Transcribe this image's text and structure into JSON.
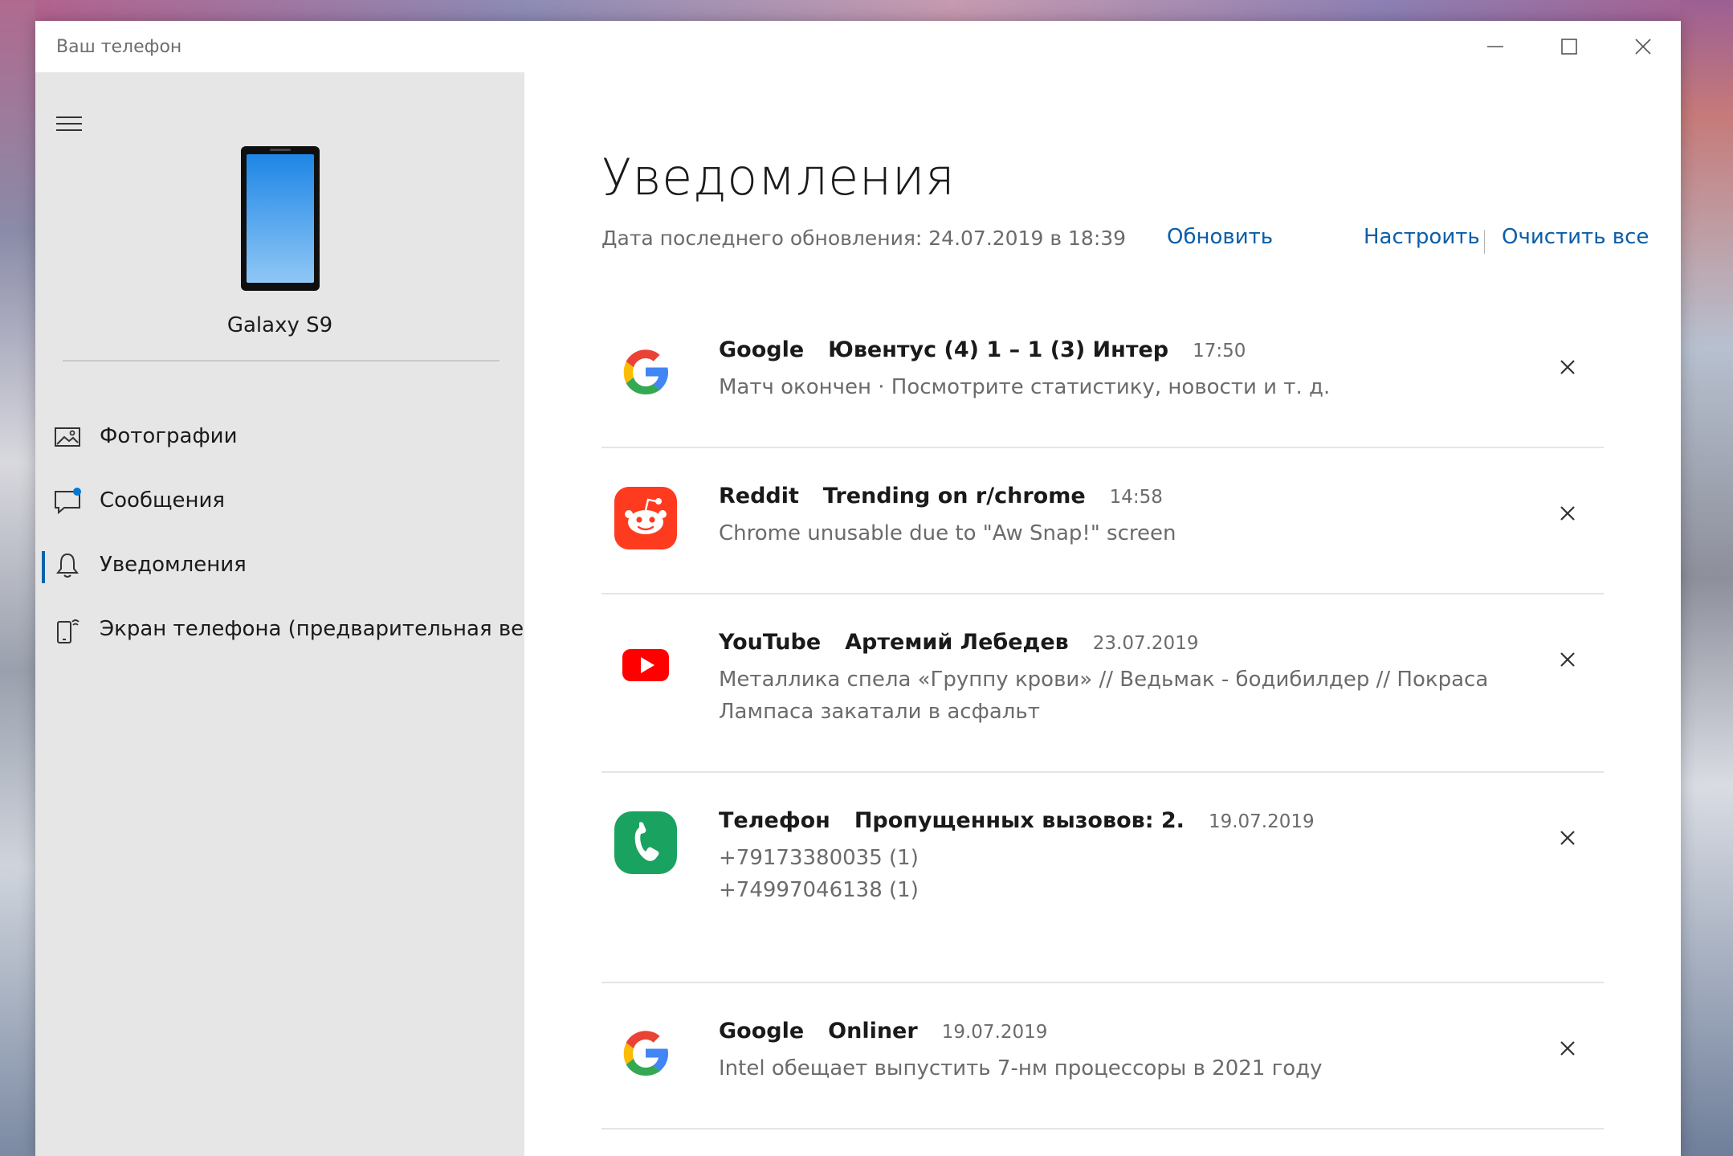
{
  "window": {
    "title": "Ваш телефон"
  },
  "sidebar": {
    "device_name": "Galaxy S9",
    "items": [
      {
        "label": "Фотографии",
        "icon": "photos-icon"
      },
      {
        "label": "Сообщения",
        "icon": "messages-icon"
      },
      {
        "label": "Уведомления",
        "icon": "bell-icon",
        "active": true
      },
      {
        "label": "Экран телефона (предварительная версия)",
        "icon": "phone-screen-icon"
      }
    ]
  },
  "main": {
    "title": "Уведомления",
    "updated_text": "Дата последнего обновления: 24.07.2019 в 18:39",
    "refresh_label": "Обновить",
    "customize_label": "Настроить",
    "clear_all_label": "Очистить все",
    "notifications": [
      {
        "app": "Google",
        "subject": "Ювентус (4) 1 – 1 (3) Интер",
        "time": "17:50",
        "body": "Матч окончен · Посмотрите статистику, новости и т. д.",
        "icon": "google-icon"
      },
      {
        "app": "Reddit",
        "subject": "Trending on r/chrome",
        "time": "14:58",
        "body": "Chrome unusable due to \"Aw Snap!\" screen",
        "icon": "reddit-icon"
      },
      {
        "app": "YouTube",
        "subject": "Артемий Лебедев",
        "time": "23.07.2019",
        "body": "Металлика спела «Группу крови» // Ведьмак - бодибилдер // Покраса Лампаса закатали в асфальт",
        "icon": "youtube-icon"
      },
      {
        "app": "Телефон",
        "subject": "Пропущенных вызовов: 2.",
        "time": "19.07.2019",
        "body_line1": "+79173380035 (1)",
        "body_line2": "+74997046138 (1)",
        "icon": "phone-app-icon"
      },
      {
        "app": "Google",
        "subject": "Onliner",
        "time": "19.07.2019",
        "body": "Intel обещает выпустить 7-нм процессоры в 2021 году",
        "icon": "google-icon"
      }
    ]
  },
  "colors": {
    "accent": "#0a5ea8",
    "sidebar_bg": "#e6e6e6",
    "reddit": "#ff4500",
    "youtube": "#ff0000",
    "phone_app": "#1aa260"
  }
}
